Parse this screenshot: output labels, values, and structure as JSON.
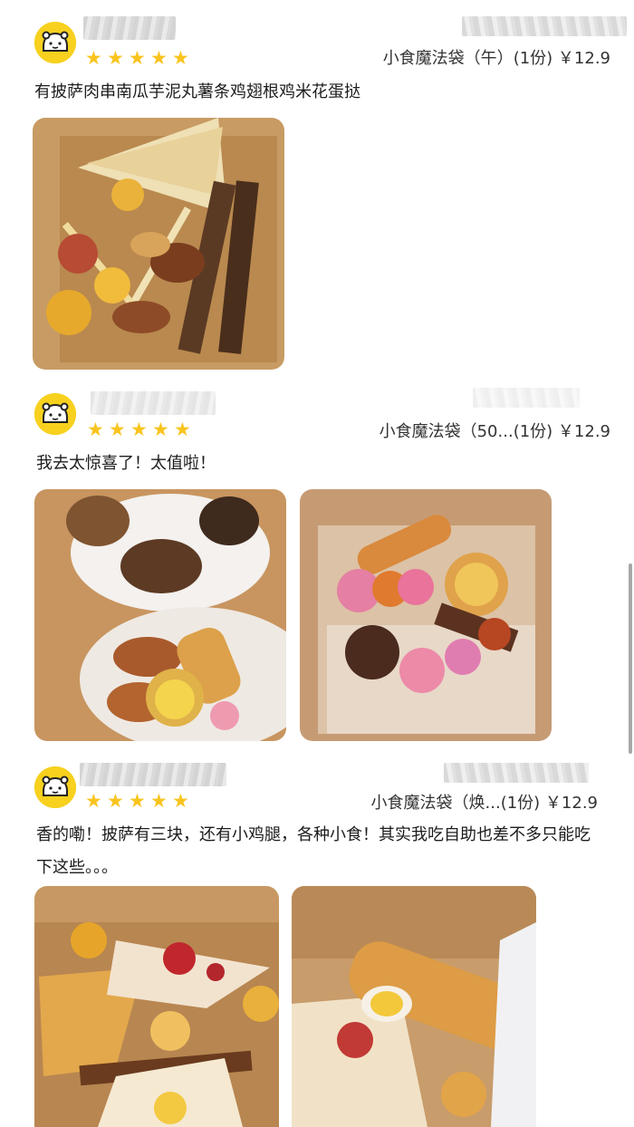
{
  "reviews": [
    {
      "rating": 5,
      "order": {
        "item": "小食魔法袋（午）",
        "qty": "(1份)",
        "price": "￥12.9"
      },
      "comment": "有披萨肉串南瓜芋泥丸薯条鸡翅根鸡米花蛋挞",
      "photos": [
        {
          "name": "review-1-photo-1",
          "subject": "pizza-skewers-fries-box"
        }
      ]
    },
    {
      "rating": 5,
      "order": {
        "item": "小食魔法袋（50...",
        "qty": "(1份)",
        "price": "￥12.9"
      },
      "comment": "我去太惊喜了！太值啦！",
      "photos": [
        {
          "name": "review-2-photo-1",
          "subject": "fried-chicken-plates"
        },
        {
          "name": "review-2-photo-2",
          "subject": "mini-burgers-bag"
        }
      ]
    },
    {
      "rating": 5,
      "order": {
        "item": "小食魔法袋（焕...",
        "qty": "(1份)",
        "price": "￥12.9"
      },
      "comment": "香的嘞！披萨有三块，还有小鸡腿，各种小食！其实我吃自助也差不多只能吃下这些。。。",
      "photos": [
        {
          "name": "review-3-photo-1",
          "subject": "pizza-slices-box"
        },
        {
          "name": "review-3-photo-2",
          "subject": "cheese-stick-pizza"
        }
      ]
    }
  ],
  "icons": {
    "avatar": "cartoon-bear-avatar-icon",
    "star": "star-icon"
  },
  "colors": {
    "star": "#f9c41e",
    "avatar_bg": "#f7d11e"
  }
}
